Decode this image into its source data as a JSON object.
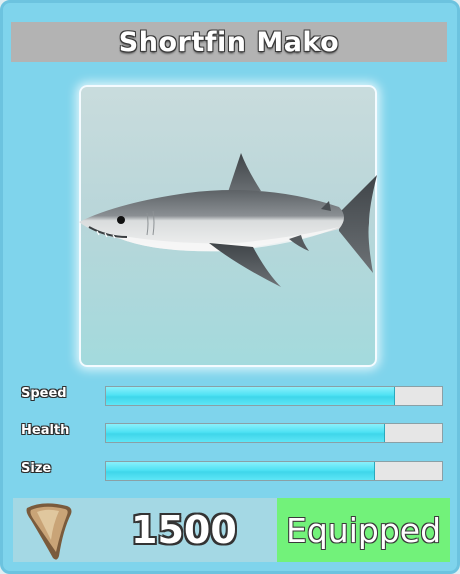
{
  "card": {
    "title": "Shortfin Mako",
    "image_subject": "shark-illustration"
  },
  "stats": [
    {
      "label": "Speed",
      "fraction": 0.86
    },
    {
      "label": "Health",
      "fraction": 0.83
    },
    {
      "label": "Size",
      "fraction": 0.8
    }
  ],
  "footer": {
    "currency_icon": "shark-tooth-icon",
    "price": "1500",
    "button_label": "Equipped"
  },
  "colors": {
    "card_background": "#7fd4ec",
    "title_bar": "#b3b3b3",
    "bar_fill": "#4fe2f4",
    "bar_track": "#e6e6e6",
    "equipped_button": "#72f27a"
  }
}
